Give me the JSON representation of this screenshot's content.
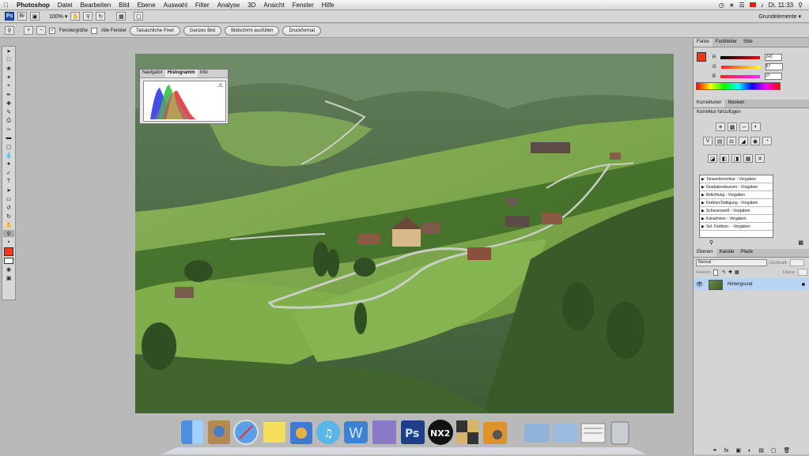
{
  "menubar": {
    "items": [
      "Photoshop",
      "Datei",
      "Bearbeiten",
      "Bild",
      "Ebene",
      "Auswahl",
      "Filter",
      "Analyse",
      "3D",
      "Ansicht",
      "Fenster",
      "Hilfe"
    ],
    "clock": "Di. 11:33",
    "workspace": "Grundelemente ▾"
  },
  "appbar": {
    "ps": "Ps",
    "zoom": "100% ▾"
  },
  "optbar": {
    "fit_windows_label": "Fenstergröße",
    "all_windows_label": "Alle Fenster",
    "buttons": [
      "Tatsächliche Pixel",
      "Ganzes Bild",
      "Bildschirm ausfüllen",
      "Druckformat"
    ]
  },
  "histogram": {
    "tabs": [
      "Navigator",
      "Histogramm",
      "Info"
    ],
    "warning": "⚠"
  },
  "panels": {
    "color_tabs": [
      "Farbe",
      "Farbfelder",
      "Stile"
    ],
    "r": {
      "label": "R",
      "value": "243"
    },
    "g": {
      "label": "G",
      "value": "57"
    },
    "b": {
      "label": "B",
      "value": "27"
    },
    "adj_tabs": [
      "Korrekturen",
      "Masken"
    ],
    "adj_title": "Korrektur hinzufügen",
    "adj_items": [
      "Tonwertkorrektur - Vorgaben",
      "Gradationskurven - Vorgaben",
      "Belichtung - Vorgaben",
      "Farbton/Sättigung - Vorgaben",
      "Schwarzweiß - Vorgaben",
      "Kanalmixer - Vorgaben",
      "Sel. Farbkorr. - Vorgaben"
    ],
    "layer_tabs": [
      "Ebenen",
      "Kanäle",
      "Pfade"
    ],
    "blend_mode": "Normal",
    "opacity_label": "Deckkraft:",
    "fix_label": "Fixieren:",
    "fill_label": "Fläche:",
    "layer_name": "Hintergrund"
  },
  "colors": {
    "foreground": "#f3391b",
    "accent": "#1f4fb5",
    "layer_selected": "#b8d3f3"
  }
}
